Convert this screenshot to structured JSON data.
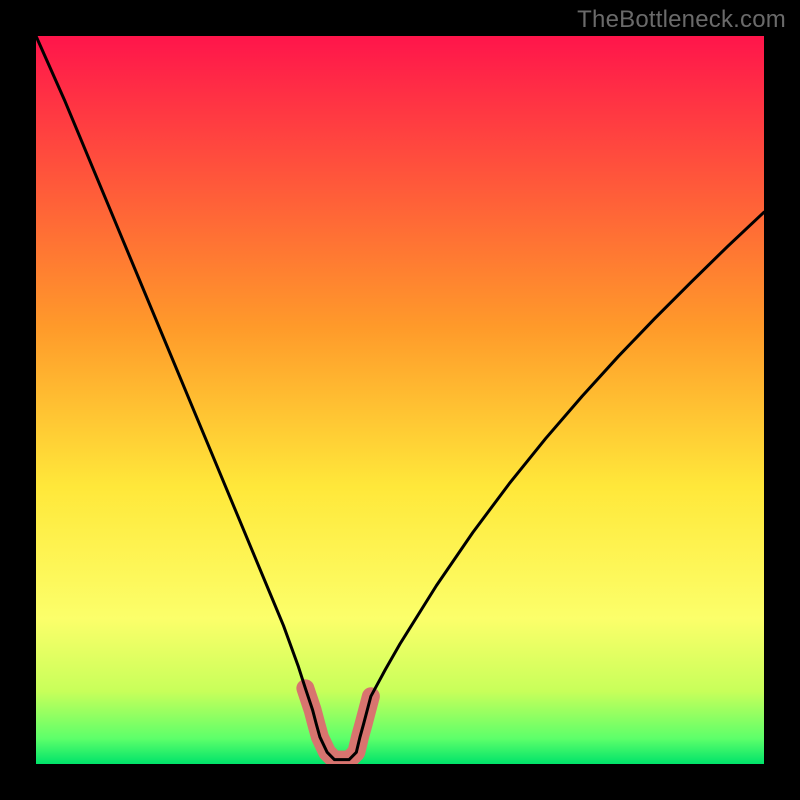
{
  "watermark": "TheBottleneck.com",
  "colors": {
    "frame": "#000000",
    "gradient_top": "#ff154b",
    "gradient_mid1": "#ff7a1e",
    "gradient_mid2": "#ffd21e",
    "gradient_mid3": "#fff760",
    "gradient_mid4": "#d7ff5a",
    "gradient_bottom": "#00e36a",
    "curve_stroke": "#000000",
    "optimal_fill": "#d8746f",
    "optimal_stroke": "#d8746f"
  },
  "chart_data": {
    "type": "line",
    "title": "",
    "xlabel": "",
    "ylabel": "",
    "xlim": [
      0,
      1
    ],
    "ylim": [
      0,
      1
    ],
    "series": [
      {
        "name": "bottleneck-curve",
        "x": [
          0.0,
          0.02,
          0.04,
          0.06,
          0.08,
          0.1,
          0.12,
          0.14,
          0.16,
          0.18,
          0.2,
          0.22,
          0.24,
          0.26,
          0.28,
          0.3,
          0.32,
          0.34,
          0.36,
          0.37,
          0.38,
          0.385,
          0.39,
          0.4,
          0.41,
          0.42,
          0.43,
          0.44,
          0.445,
          0.45,
          0.455,
          0.46,
          0.48,
          0.5,
          0.55,
          0.6,
          0.65,
          0.7,
          0.75,
          0.8,
          0.85,
          0.9,
          0.95,
          1.0
        ],
        "values": [
          1.0,
          0.955,
          0.91,
          0.862,
          0.814,
          0.766,
          0.718,
          0.67,
          0.622,
          0.574,
          0.526,
          0.478,
          0.43,
          0.382,
          0.334,
          0.286,
          0.238,
          0.19,
          0.135,
          0.104,
          0.074,
          0.055,
          0.037,
          0.016,
          0.006,
          0.006,
          0.006,
          0.016,
          0.037,
          0.055,
          0.074,
          0.093,
          0.13,
          0.165,
          0.245,
          0.318,
          0.385,
          0.447,
          0.505,
          0.56,
          0.612,
          0.662,
          0.711,
          0.758
        ]
      }
    ],
    "optimal_zone": {
      "x_start": 0.37,
      "x_end": 0.46,
      "threshold": 0.105
    },
    "gradient_bands": [
      {
        "stop": 0.0,
        "color": "#ff154b"
      },
      {
        "stop": 0.4,
        "color": "#ff9a2a"
      },
      {
        "stop": 0.62,
        "color": "#ffe83a"
      },
      {
        "stop": 0.8,
        "color": "#fcff6a"
      },
      {
        "stop": 0.9,
        "color": "#c8ff5a"
      },
      {
        "stop": 0.965,
        "color": "#5dff6a"
      },
      {
        "stop": 1.0,
        "color": "#00e36a"
      }
    ]
  }
}
